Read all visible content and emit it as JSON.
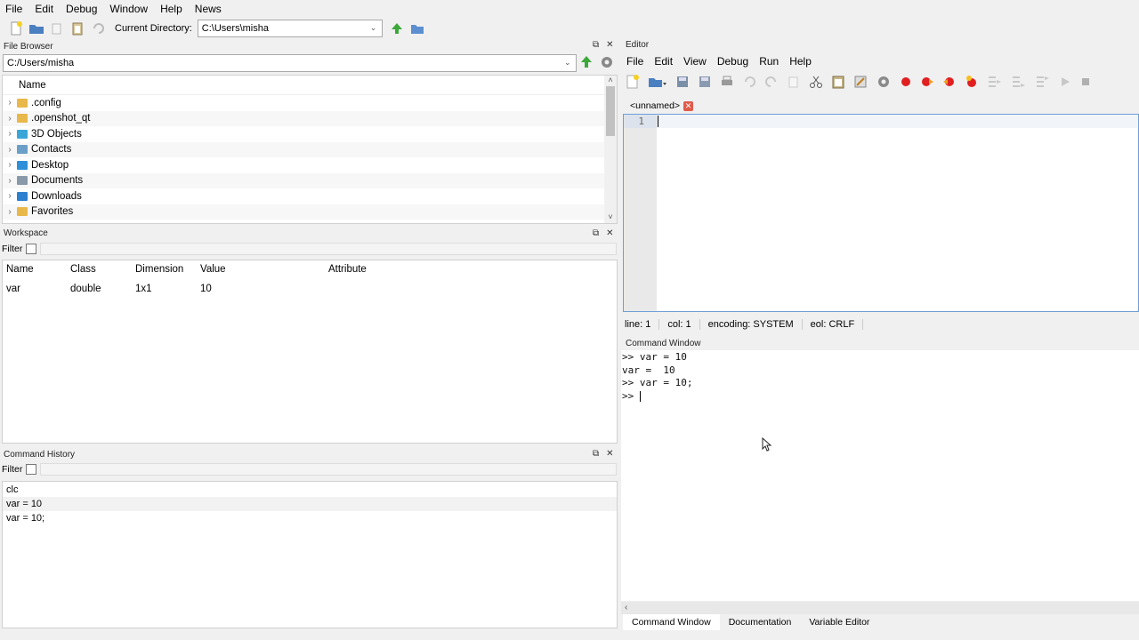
{
  "menubar": {
    "items": [
      "File",
      "Edit",
      "Debug",
      "Window",
      "Help",
      "News"
    ]
  },
  "toolbar": {
    "current_dir_label": "Current Directory:",
    "current_dir_value": "C:\\Users\\misha"
  },
  "file_browser": {
    "title": "File Browser",
    "path": "C:/Users/misha",
    "column_name": "Name",
    "items": [
      {
        "label": ".config",
        "color": "#e8b84a"
      },
      {
        "label": ".openshot_qt",
        "color": "#e8b84a"
      },
      {
        "label": "3D Objects",
        "color": "#3aa6d8"
      },
      {
        "label": "Contacts",
        "color": "#6a9fc8"
      },
      {
        "label": "Desktop",
        "color": "#2f8fd8"
      },
      {
        "label": "Documents",
        "color": "#8899aa"
      },
      {
        "label": "Downloads",
        "color": "#2d7fd0"
      },
      {
        "label": "Favorites",
        "color": "#e8b84a"
      }
    ]
  },
  "workspace": {
    "title": "Workspace",
    "filter_label": "Filter",
    "columns": [
      "Name",
      "Class",
      "Dimension",
      "Value",
      "Attribute"
    ],
    "rows": [
      [
        "var",
        "double",
        "1x1",
        "10",
        ""
      ]
    ]
  },
  "command_history": {
    "title": "Command History",
    "filter_label": "Filter",
    "entries": [
      "clc",
      "var = 10",
      "var = 10;"
    ]
  },
  "editor": {
    "title": "Editor",
    "menu": [
      "File",
      "Edit",
      "View",
      "Debug",
      "Run",
      "Help"
    ],
    "tab_label": "<unnamed>",
    "line_number": "1",
    "status": {
      "line": "line: 1",
      "col": "col: 1",
      "encoding": "encoding: SYSTEM",
      "eol": "eol: CRLF"
    }
  },
  "command_window": {
    "title": "Command Window",
    "lines": [
      ">> var = 10",
      "var =  10",
      ">> var = 10;",
      ">> "
    ]
  },
  "bottom_tabs": [
    "Command Window",
    "Documentation",
    "Variable Editor"
  ],
  "colors": {
    "accent_border": "#6f9fd8",
    "selected_row": "#f2f2f2",
    "breakpoint_red": "#e02020"
  }
}
